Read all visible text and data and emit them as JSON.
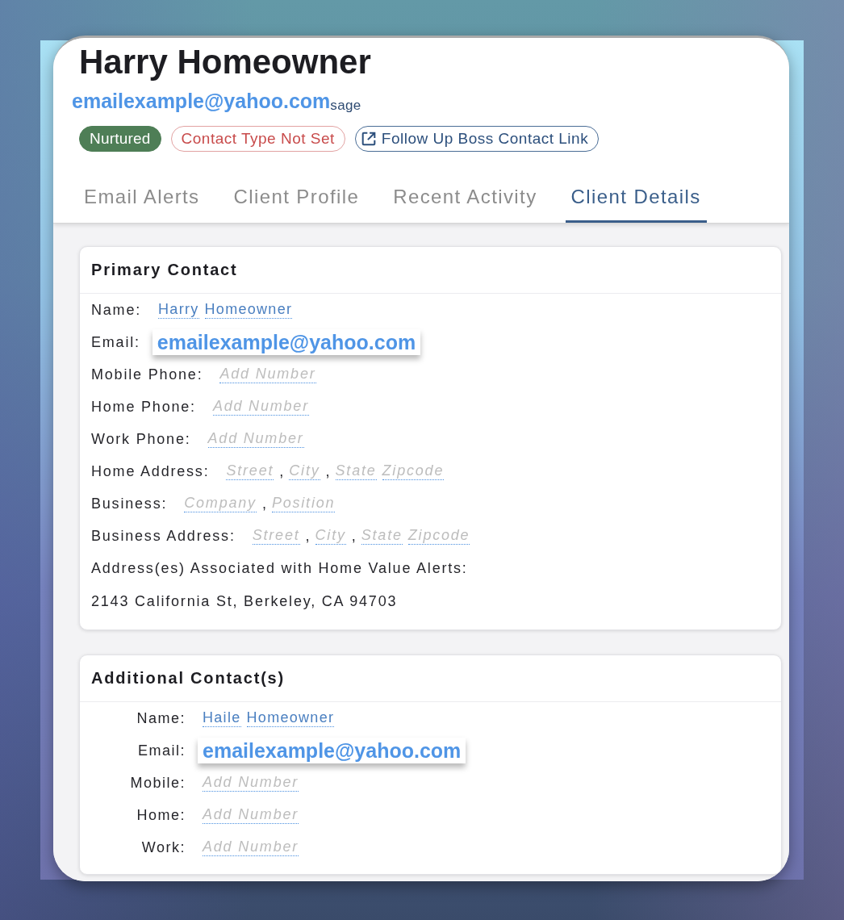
{
  "header": {
    "name": "Harry Homeowner",
    "email": "emailexample@yahoo.com",
    "covered_text": "sage"
  },
  "badges": [
    {
      "label": "Nurtured",
      "kind": "status"
    },
    {
      "label": "Contact Type Not Set",
      "kind": "warning"
    },
    {
      "label": "Follow Up Boss Contact Link",
      "kind": "link"
    }
  ],
  "tabs": [
    {
      "label": "Email Alerts",
      "selected": false
    },
    {
      "label": "Client Profile",
      "selected": false
    },
    {
      "label": "Recent Activity",
      "selected": false
    },
    {
      "label": "Client Details",
      "selected": true
    }
  ],
  "primary_contact": {
    "title": "Primary Contact",
    "fields": [
      {
        "label": "Name:",
        "kind": "editable",
        "parts": [
          {
            "kind": "field",
            "value": "Harry"
          },
          {
            "kind": "field",
            "value": "Homeowner"
          }
        ]
      },
      {
        "label": "Email:",
        "kind": "email",
        "value": "emailexample@yahoo.com"
      },
      {
        "label": "Mobile Phone:",
        "kind": "editable",
        "parts": [
          {
            "kind": "field",
            "placeholder": "Add Number"
          }
        ]
      },
      {
        "label": "Home Phone:",
        "kind": "editable",
        "parts": [
          {
            "kind": "field",
            "placeholder": "Add Number"
          }
        ]
      },
      {
        "label": "Work Phone:",
        "kind": "editable",
        "parts": [
          {
            "kind": "field",
            "placeholder": "Add Number"
          }
        ]
      },
      {
        "label": "Home Address:",
        "kind": "editable",
        "parts": [
          {
            "kind": "field",
            "placeholder": "Street"
          },
          {
            "kind": "separator",
            "text": ","
          },
          {
            "kind": "field",
            "placeholder": "City"
          },
          {
            "kind": "separator",
            "text": ","
          },
          {
            "kind": "field",
            "placeholder": "State"
          },
          {
            "kind": "field",
            "placeholder": "Zipcode"
          }
        ]
      },
      {
        "label": "Business:",
        "kind": "editable",
        "parts": [
          {
            "kind": "field",
            "placeholder": "Company"
          },
          {
            "kind": "separator",
            "text": ","
          },
          {
            "kind": "field",
            "placeholder": "Position"
          }
        ]
      },
      {
        "label": "Business Address:",
        "kind": "editable",
        "parts": [
          {
            "kind": "field",
            "placeholder": "Street"
          },
          {
            "kind": "separator",
            "text": ","
          },
          {
            "kind": "field",
            "placeholder": "City"
          },
          {
            "kind": "separator",
            "text": ","
          },
          {
            "kind": "field",
            "placeholder": "State"
          },
          {
            "kind": "field",
            "placeholder": "Zipcode"
          }
        ]
      }
    ],
    "home_value_alerts": {
      "label": "Address(es) Associated with Home Value Alerts:",
      "addresses": [
        "2143 California St, Berkeley, CA 94703"
      ]
    }
  },
  "additional_contacts": {
    "title": "Additional Contact(s)",
    "fields": [
      {
        "label": "Name:",
        "kind": "editable",
        "parts": [
          {
            "kind": "field",
            "value": "Haile"
          },
          {
            "kind": "field",
            "value": "Homeowner"
          }
        ]
      },
      {
        "label": "Email:",
        "kind": "email",
        "value": "emailexample@yahoo.com"
      },
      {
        "label": "Mobile:",
        "kind": "editable",
        "parts": [
          {
            "kind": "field",
            "placeholder": "Add Number"
          }
        ]
      },
      {
        "label": "Home:",
        "kind": "editable",
        "parts": [
          {
            "kind": "field",
            "placeholder": "Add Number"
          }
        ]
      },
      {
        "label": "Work:",
        "kind": "editable",
        "parts": [
          {
            "kind": "field",
            "placeholder": "Add Number"
          }
        ]
      }
    ]
  }
}
